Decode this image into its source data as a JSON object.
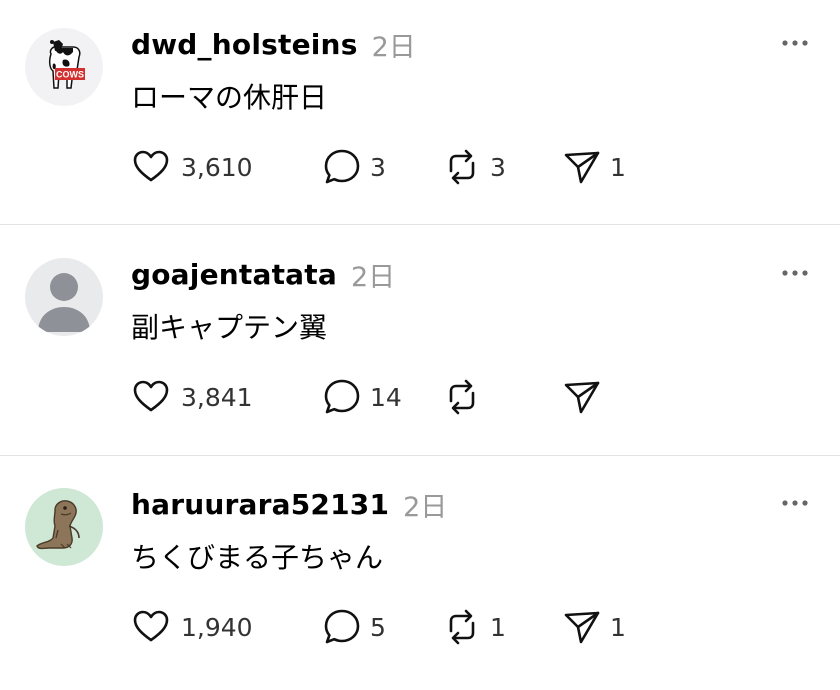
{
  "posts": [
    {
      "username": "dwd_holsteins",
      "time": "2日",
      "text": "ローマの休肝日",
      "avatar": {
        "icon": "cow-icon",
        "badge": "COWS",
        "bg": "#f2f2f4"
      },
      "likes": "3,610",
      "replies": "3",
      "reposts": "3",
      "shares": "1"
    },
    {
      "username": "goajentatata",
      "time": "2日",
      "text": "副キャプテン翼",
      "avatar": {
        "icon": "default-avatar-icon",
        "bg": "#e9eaec"
      },
      "likes": "3,841",
      "replies": "14",
      "reposts": "",
      "shares": ""
    },
    {
      "username": "haruurara52131",
      "time": "2日",
      "text": "ちくびまる子ちゃん",
      "avatar": {
        "icon": "lizard-icon",
        "bg": "#cfe8d6"
      },
      "likes": "1,940",
      "replies": "5",
      "reposts": "1",
      "shares": "1"
    }
  ],
  "colors": {
    "text": "#000000",
    "muted": "#999999",
    "divider": "#e3e3e3",
    "badge": "#d32f2f"
  }
}
